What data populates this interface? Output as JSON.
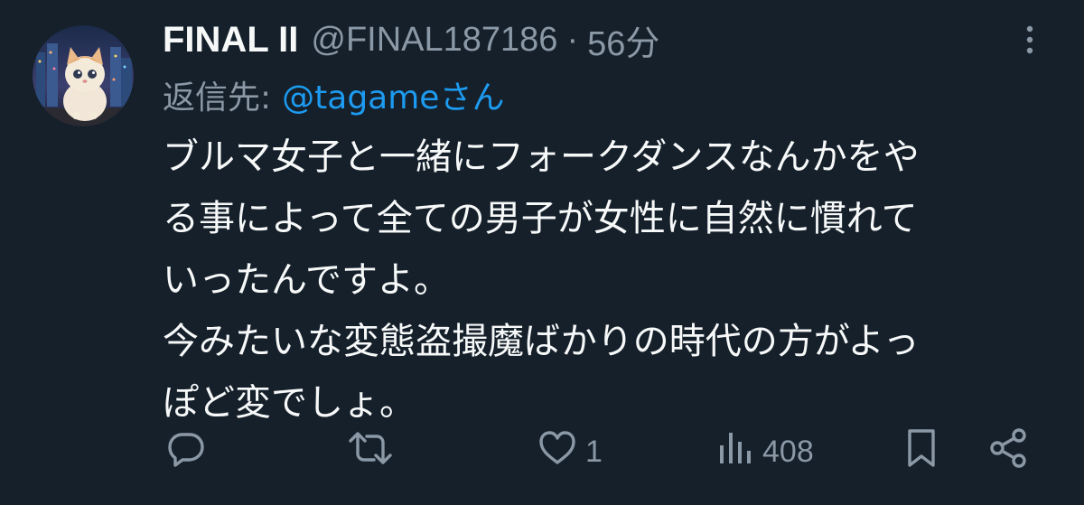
{
  "tweet": {
    "display_name": "FINAL II",
    "handle": "@FINAL187186",
    "separator": "·",
    "time": "56分",
    "reply_label": "返信先:",
    "reply_mention": "@tagameさん",
    "body_lines": [
      "ブルマ女子と一緒にフォークダンスなんかをや",
      "る事によって全ての男子が女性に自然に慣れて",
      "いったんですよ。",
      "今みたいな変態盗撮魔ばかりの時代の方がよっ",
      "ぽど変でしょ。"
    ]
  },
  "actions": {
    "reply_icon": "reply-icon",
    "retweet_icon": "retweet-icon",
    "like_icon": "heart-icon",
    "like_count": "1",
    "views_icon": "views-icon",
    "views_count": "408",
    "bookmark_icon": "bookmark-icon",
    "share_icon": "share-icon"
  },
  "colors": {
    "background": "#15202b",
    "text": "#f7f9f9",
    "muted": "#8b98a5",
    "accent": "#1d9bf0"
  }
}
